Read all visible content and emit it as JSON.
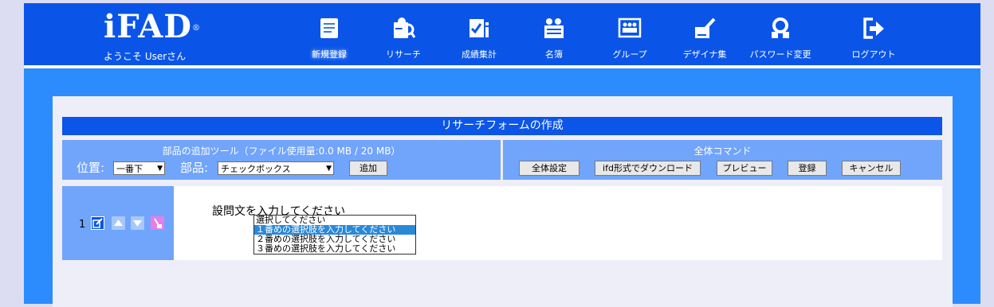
{
  "header": {
    "logo": "iFAD",
    "logo_mark": "®",
    "welcome": "ようこそ Userさん",
    "nav": [
      {
        "label": "新規登録",
        "icon": "new-document-icon"
      },
      {
        "label": "リサーチ",
        "icon": "research-icon"
      },
      {
        "label": "成績集計",
        "icon": "grade-summary-icon"
      },
      {
        "label": "名簿",
        "icon": "roster-icon"
      },
      {
        "label": "グループ",
        "icon": "group-icon"
      },
      {
        "label": "デザイナ集",
        "icon": "designer-icon"
      },
      {
        "label": "パスワード変更",
        "icon": "password-change-icon"
      },
      {
        "label": "ログアウト",
        "icon": "logout-icon"
      }
    ]
  },
  "form": {
    "title": "リサーチフォームの作成",
    "tools": {
      "title": "部品の追加ツール（ファイル使用量:0.0 MB / 20 MB）",
      "position_label": "位置:",
      "position_value": "一番下",
      "part_label": "部品:",
      "part_value": "チェックボックス",
      "add_button": "追加"
    },
    "commands": {
      "title": "全体コマンド",
      "buttons": [
        "全体設定",
        "ifd形式でダウンロード",
        "プレビュー",
        "登録",
        "キャンセル"
      ]
    },
    "question": {
      "number": "1",
      "text": "設問文を入力してください",
      "options": [
        "選択してください",
        "１番めの選択肢を入力してください",
        "２番めの選択肢を入力してください",
        "３番めの選択肢を入力してください"
      ],
      "highlighted_index": 1
    }
  },
  "colors": {
    "header": "#0a55e8",
    "frame": "#2c8cfd",
    "toolbar": "#71a4fb",
    "title_bar": "#0b55e8",
    "highlight": "#2a88d8"
  }
}
